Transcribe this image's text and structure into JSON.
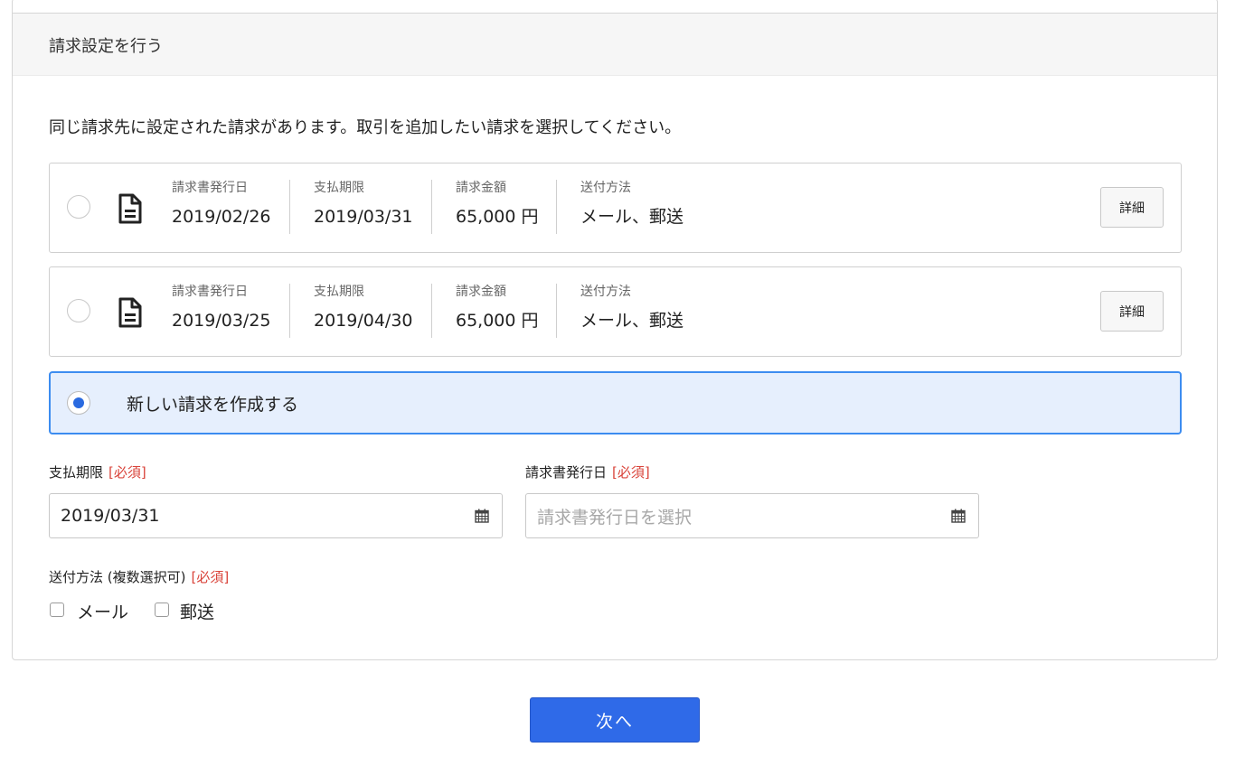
{
  "section": {
    "title": "請求設定を行う",
    "intro": "同じ請求先に設定された請求があります。取引を追加したい請求を選択してください。"
  },
  "invoices": [
    {
      "issue_label": "請求書発行日",
      "issue_date": "2019/02/26",
      "due_label": "支払期限",
      "due_date": "2019/03/31",
      "amount_label": "請求金額",
      "amount": "65,000 円",
      "method_label": "送付方法",
      "method": "メール、郵送",
      "detail_label": "詳細",
      "selected": false
    },
    {
      "issue_label": "請求書発行日",
      "issue_date": "2019/03/25",
      "due_label": "支払期限",
      "due_date": "2019/04/30",
      "amount_label": "請求金額",
      "amount": "65,000 円",
      "method_label": "送付方法",
      "method": "メール、郵送",
      "detail_label": "詳細",
      "selected": false
    }
  ],
  "new_invoice": {
    "label": "新しい請求を作成する",
    "selected": true
  },
  "form": {
    "due": {
      "label": "支払期限",
      "required": "[必須]",
      "value": "2019/03/31"
    },
    "issue": {
      "label": "請求書発行日",
      "required": "[必須]",
      "placeholder": "請求書発行日を選択"
    },
    "method": {
      "label": "送付方法 (複数選択可)",
      "required": "[必須]",
      "options": [
        {
          "label": "メール",
          "checked": false
        },
        {
          "label": "郵送",
          "checked": false
        }
      ]
    }
  },
  "next_button": "次へ",
  "colors": {
    "accent": "#2f6ae8",
    "selected_bg": "#e6effd",
    "required": "#d9433a"
  }
}
